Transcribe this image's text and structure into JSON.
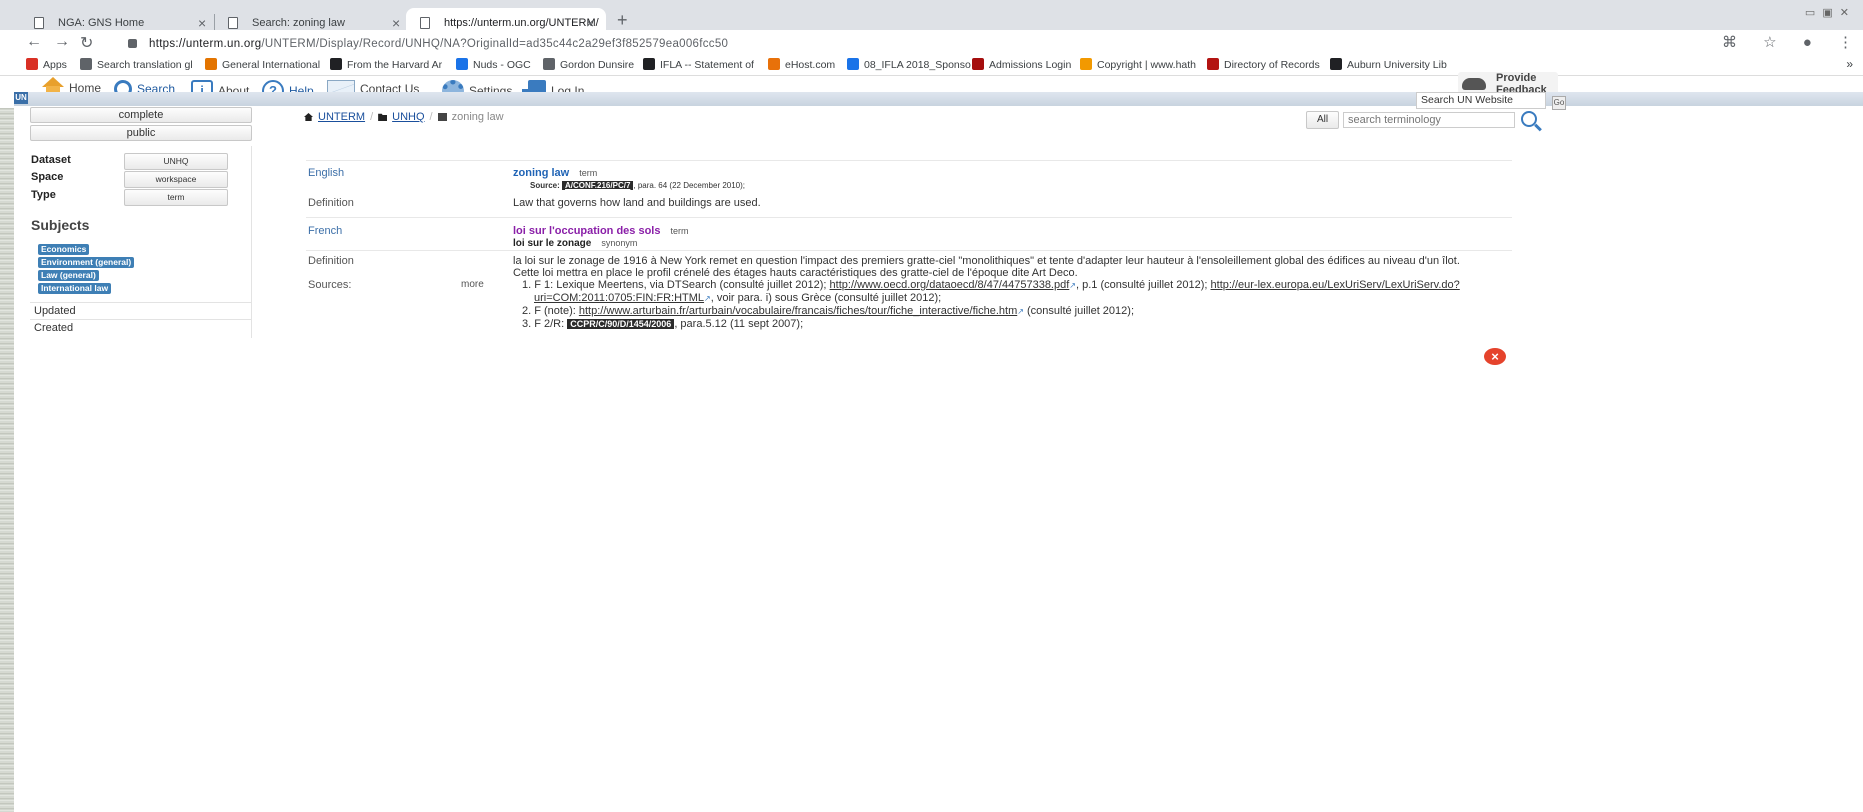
{
  "browser": {
    "tabs": [
      {
        "label": "NGA: GNS Home",
        "close": "×"
      },
      {
        "label": "Search: zoning law",
        "close": "×"
      },
      {
        "label": "https://unterm.un.org/UNTERM/",
        "close": "×"
      }
    ],
    "new_tab": "+",
    "window_controls": "▭ ▣ ✕",
    "url_host": "https://unterm.un.org",
    "url_path": "/UNTERM/Display/Record/UNHQ/NA?OriginalId=ad35c44c2a29ef3f852579ea006fcc50",
    "bookmarks": [
      {
        "label": "Apps",
        "color": "#d93025"
      },
      {
        "label": "Search translation gl",
        "color": "#5f6368"
      },
      {
        "label": "General International",
        "color": "#e37400"
      },
      {
        "label": "From the Harvard Ar",
        "color": "#202124"
      },
      {
        "label": "Nuds - OGC",
        "color": "#1a73e8"
      },
      {
        "label": "Gordon Dunsire",
        "color": "#5f6368"
      },
      {
        "label": "IFLA -- Statement of",
        "color": "#202124"
      },
      {
        "label": "eHost.com",
        "color": "#e8710a"
      },
      {
        "label": "08_IFLA 2018_Sponso",
        "color": "#1a73e8"
      },
      {
        "label": "Admissions Login",
        "color": "#a50e0e"
      },
      {
        "label": "Copyright | www.hath",
        "color": "#f29900"
      },
      {
        "label": "Directory of Records",
        "color": "#b31412"
      },
      {
        "label": "Auburn University Lib",
        "color": "#202124"
      }
    ],
    "bookmarks_more": "»"
  },
  "site_nav": {
    "home": "Home",
    "search": "Search",
    "about": "About",
    "help": "Help",
    "contact": "Contact Us",
    "settings": "Settings",
    "login": "Log In",
    "feedback": "Provide Feedback"
  },
  "un_strip": {
    "logo": "UN",
    "search_un": "Search UN Website",
    "go": "Go"
  },
  "left_panel": {
    "status_buttons": [
      "complete",
      "public"
    ],
    "facets": [
      {
        "label": "Dataset",
        "value": "UNHQ"
      },
      {
        "label": "Space",
        "value": "workspace"
      },
      {
        "label": "Type",
        "value": "term"
      }
    ],
    "subjects_title": "Subjects",
    "subjects": [
      "Economics",
      "Environment (general)",
      "Law (general)",
      "International law"
    ],
    "updated": "Updated",
    "created": "Created"
  },
  "breadcrumb": [
    "UNTERM",
    "UNHQ",
    "zoning law"
  ],
  "search": {
    "scope": "All",
    "placeholder": "search terminology"
  },
  "record": {
    "english": {
      "lang_label": "English",
      "term": "zoning law",
      "term_type": "term",
      "source_label": "Source:",
      "source_doc": "A/CONF.216/PC/7",
      "source_rest": ", para. 64 (22 December 2010);",
      "definition_label": "Definition",
      "definition": "Law that governs how land and buildings are used."
    },
    "french": {
      "lang_label": "French",
      "term": "loi sur l'occupation des sols",
      "term_type": "term",
      "synonym": "loi sur le zonage",
      "synonym_type": "synonym",
      "definition_label": "Definition",
      "definition_line1": "la loi sur le zonage de 1916 à New York remet en question l'impact des premiers gratte-ciel \"monolithiques\" et tente d'adapter leur hauteur à l'ensoleillement global des édifices au niveau d'un îlot.",
      "definition_line2": "Cette loi mettra en place le profil crénelé des étages hauts caractéristiques des gratte-ciel de l'époque dite Art Deco.",
      "sources_label": "Sources:",
      "more": "more",
      "sources": {
        "s1_a": "1. F 1: Lexique Meertens, via DTSearch (consulté juillet 2012); ",
        "s1_link1": "http://www.oecd.org/dataoecd/8/47/44757338.pdf",
        "s1_b": ", p.1 (consulté juillet 2012); ",
        "s1_link2a": "http://eur-lex.europa.eu/LexUriServ/LexUriServ.do?",
        "s1_link2b": "uri=COM:2011:0705:FIN:FR:HTML",
        "s1_c": ", voir para. i) sous Grèce (consulté juillet 2012);",
        "s2_a": "2. F (note): ",
        "s2_link": "http://www.arturbain.fr/arturbain/vocabulaire/francais/fiches/tour/fiche_interactive/fiche.htm",
        "s2_b": " (consulté juillet 2012);",
        "s3_a": "3. F 2/R: ",
        "s3_doc": "CCPR/C/90/D/1454/2006",
        "s3_b": ", para.5.12 (11 sept 2007);"
      }
    },
    "close": "×"
  }
}
